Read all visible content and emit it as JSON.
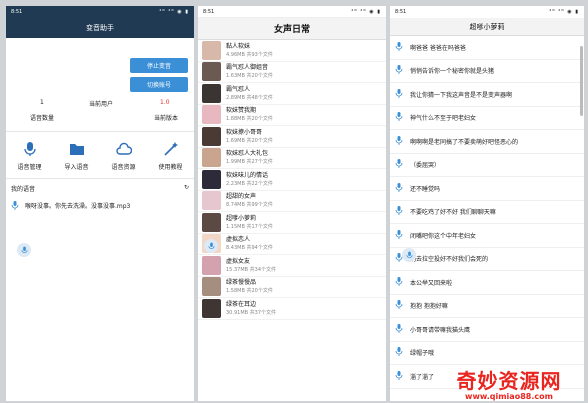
{
  "status_time": "8:51",
  "status_icons": "⁴ᴳ ⁴ᴳ ◉ ▮",
  "screen1": {
    "title": "变音助手",
    "stop_label": "停止变音",
    "switch_label": "切换账号",
    "voice_count_value": "1",
    "voice_count_label": "语音数量",
    "current_user_label": "当前用户",
    "version_value": "1.0",
    "version_label": "当前版本",
    "tools": [
      {
        "label": "语音管理",
        "icon": "mic-icon"
      },
      {
        "label": "导入语音",
        "icon": "folder-icon"
      },
      {
        "label": "语音资源",
        "icon": "cloud-icon"
      },
      {
        "label": "使用教程",
        "icon": "magic-wand-icon"
      }
    ],
    "my_voice_label": "我的语音",
    "refresh_glyph": "↻",
    "voice_item": "喉呀没事。你先去洗澡。没事没事.mp3"
  },
  "screen2": {
    "title": "女声日常",
    "packs": [
      {
        "name": "黏人软妹",
        "meta": "4.96MB  共93个文件",
        "color": "#d8b8a8"
      },
      {
        "name": "霸气怼人御姐音",
        "meta": "1.63MB  共20个文件",
        "color": "#6b5a52"
      },
      {
        "name": "霸气怼人",
        "meta": "2.89MB  共48个文件",
        "color": "#3a3532"
      },
      {
        "name": "软妹赞我期",
        "meta": "1.88MB  共20个文件",
        "color": "#e8b8c0"
      },
      {
        "name": "软妹撩小哥哥",
        "meta": "1.69MB  共20个文件",
        "color": "#4a3a35"
      },
      {
        "name": "软妹怼人大礼包",
        "meta": "1.99MB  共27个文件",
        "color": "#c9a48e"
      },
      {
        "name": "软妹味儿的情话",
        "meta": "2.23MB  共22个文件",
        "color": "#2d2a3a"
      },
      {
        "name": "超甜的女声",
        "meta": "8.74MB  共99个文件",
        "color": "#e6c7cf"
      },
      {
        "name": "超嗲小萝莉",
        "meta": "1.15MB  共17个文件",
        "color": "#5b4a44"
      },
      {
        "name": "虚拟恋人",
        "meta": "8.43MB  共94个文件",
        "color": "#f2d6c6"
      },
      {
        "name": "虚拟女友",
        "meta": "15.37MB  共34个文件",
        "color": "#d4a1ae"
      },
      {
        "name": "绿茶慢慢品",
        "meta": "1.58MB  共20个文件",
        "color": "#a58d80"
      },
      {
        "name": "绿茶在耳边",
        "meta": "30.91MB  共37个文件",
        "color": "#3f3634"
      }
    ]
  },
  "screen3": {
    "title": "超嗲小萝莉",
    "phrases": [
      "啊爸爸 爸爸在吗爸爸",
      "悄悄告诉你一个秘密你就是头猪",
      "我让你猜一下我这声音是不是变声器啊",
      "神气什么不至于吧老妇女",
      "啊啊啊是老同搞了不要卖萌好吧怪恶心的",
      "（委屈哭）",
      "还不睡觉吗",
      "不要吃鸡了好不好 我们聊聊天嘛",
      "闭嘴吧你这个中年老妇女",
      "别去拉空投好不好我们会死的",
      "本公举又回来啦",
      "抱抱 抱抱好嘛",
      "小哥哥请带嘛我猫头鹰",
      "绿帽子哦",
      "淄了淄了"
    ]
  },
  "watermark": {
    "main": "奇妙资源网",
    "url": "www.qimiao88.com"
  }
}
